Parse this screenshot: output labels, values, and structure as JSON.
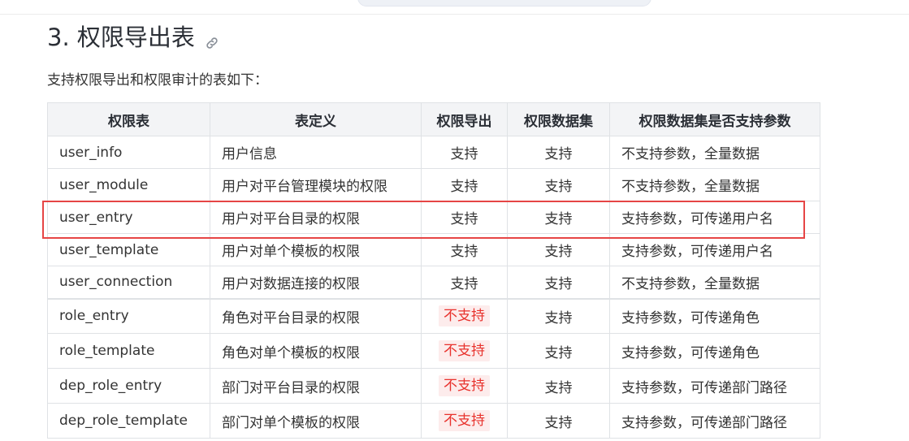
{
  "heading": {
    "title": "3. 权限导出表",
    "link_icon": "link-icon"
  },
  "intro": "支持权限导出和权限审计的表如下：",
  "table": {
    "headers": [
      "权限表",
      "表定义",
      "权限导出",
      "权限数据集",
      "权限数据集是否支持参数"
    ],
    "rows": [
      {
        "name": "user_info",
        "definition": "用户信息",
        "export": "支持",
        "dataset": "支持",
        "params": "不支持参数，全量数据"
      },
      {
        "name": "user_module",
        "definition": "用户对平台管理模块的权限",
        "export": "支持",
        "dataset": "支持",
        "params": "不支持参数，全量数据"
      },
      {
        "name": "user_entry",
        "definition": "用户对平台目录的权限",
        "export": "支持",
        "dataset": "支持",
        "params": "支持参数，可传递用户名"
      },
      {
        "name": "user_template",
        "definition": "用户对单个模板的权限",
        "export": "支持",
        "dataset": "支持",
        "params": "支持参数，可传递用户名"
      },
      {
        "name": "user_connection",
        "definition": "用户对数据连接的权限",
        "export": "支持",
        "dataset": "支持",
        "params": "不支持参数，全量数据"
      },
      {
        "name": "role_entry",
        "definition": "角色对平台目录的权限",
        "export": "不支持",
        "dataset": "支持",
        "params": "支持参数，可传递角色"
      },
      {
        "name": "role_template",
        "definition": "角色对单个模板的权限",
        "export": "不支持",
        "dataset": "支持",
        "params": "支持参数，可传递角色"
      },
      {
        "name": "dep_role_entry",
        "definition": "部门对平台目录的权限",
        "export": "不支持",
        "dataset": "支持",
        "params": "支持参数，可传递部门路径"
      },
      {
        "name": "dep_role_template",
        "definition": "部门对单个模板的权限",
        "export": "不支持",
        "dataset": "支持",
        "params": "支持参数，可传递部门路径"
      }
    ],
    "highlighted_row_index": 2
  },
  "colors": {
    "highlight_border": "#e64545",
    "not_supported_text": "#e8322d",
    "not_supported_bg": "#fdecec",
    "header_bg": "#f3f4f6",
    "border": "#dfe2e5"
  }
}
